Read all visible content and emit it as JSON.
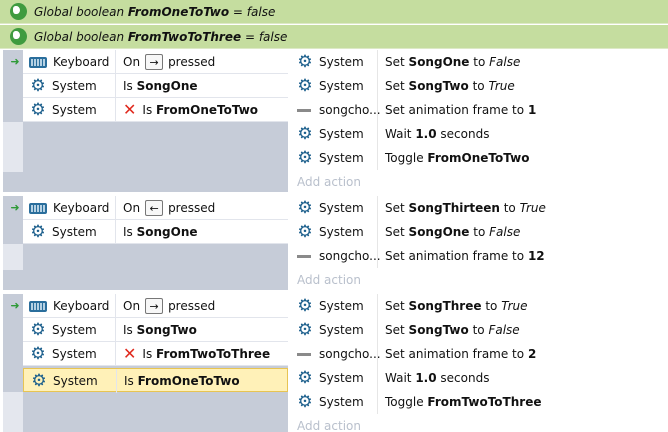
{
  "globals": [
    {
      "prefix": "Global boolean",
      "name": "FromOneToTwo",
      "suffix": "= false"
    },
    {
      "prefix": "Global boolean",
      "name": "FromTwoToThree",
      "suffix": "= false"
    }
  ],
  "common": {
    "system": "System",
    "keyboard": "Keyboard",
    "on": "On",
    "pressed": "pressed",
    "is": "Is",
    "set": "Set",
    "to": "to",
    "wait": "Wait",
    "seconds": "seconds",
    "toggle": "Toggle",
    "set_frame": "Set animation frame to",
    "songcho": "songcho...",
    "add_action": "Add action"
  },
  "blocks": [
    {
      "key_arrow": "→",
      "conditions": [
        "SongOne",
        "FromOneToTwo"
      ],
      "actions": {
        "set_var_1": "SongOne",
        "set_val_1": "False",
        "set_var_2": "SongTwo",
        "set_val_2": "True",
        "frame": "1",
        "wait_secs": "1.0",
        "toggle_var": "FromOneToTwo"
      }
    },
    {
      "key_arrow": "←",
      "conditions": [
        "SongOne"
      ],
      "actions": {
        "set_var_1": "SongThirteen",
        "set_val_1": "True",
        "set_var_2": "SongOne",
        "set_val_2": "False",
        "frame": "12"
      }
    },
    {
      "key_arrow": "→",
      "conditions": [
        "SongTwo",
        "FromTwoToThree",
        "FromOneToTwo"
      ],
      "actions": {
        "set_var_1": "SongThree",
        "set_val_1": "True",
        "set_var_2": "SongTwo",
        "set_val_2": "False",
        "frame": "2",
        "wait_secs": "1.0",
        "toggle_var": "FromTwoToThree"
      }
    }
  ]
}
